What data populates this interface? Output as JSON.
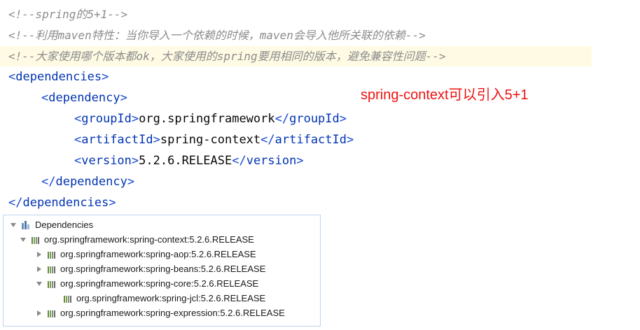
{
  "editor": {
    "comments": [
      "<!--spring的5+1-->",
      "<!--利用maven特性：当你导入一个依赖的时候，maven会导入他所关联的依赖-->",
      "<!--大家使用哪个版本都ok，大家使用的spring要用相同的版本，避免兼容性问题-->"
    ],
    "dependencies_tag": "dependencies",
    "dependency_tag": "dependency",
    "groupId_tag": "groupId",
    "groupId_value": "org.springframework",
    "artifactId_tag": "artifactId",
    "artifactId_value": "spring-context",
    "version_tag": "version",
    "version_value": "5.2.6.RELEASE"
  },
  "annotation": "spring-context可以引入5+1",
  "tree": {
    "root_label": "Dependencies",
    "items": [
      {
        "label": "org.springframework:spring-context:5.2.6.RELEASE",
        "expanded": "down"
      },
      {
        "label": "org.springframework:spring-aop:5.2.6.RELEASE",
        "expanded": "right"
      },
      {
        "label": "org.springframework:spring-beans:5.2.6.RELEASE",
        "expanded": "right"
      },
      {
        "label": "org.springframework:spring-core:5.2.6.RELEASE",
        "expanded": "down"
      },
      {
        "label": "org.springframework:spring-jcl:5.2.6.RELEASE",
        "expanded": "none"
      },
      {
        "label": "org.springframework:spring-expression:5.2.6.RELEASE",
        "expanded": "right"
      }
    ]
  },
  "colors": {
    "tag": "#0033b3",
    "comment": "#8c8c8c",
    "annotation": "#ee1111",
    "highlight": "#fffae3"
  }
}
